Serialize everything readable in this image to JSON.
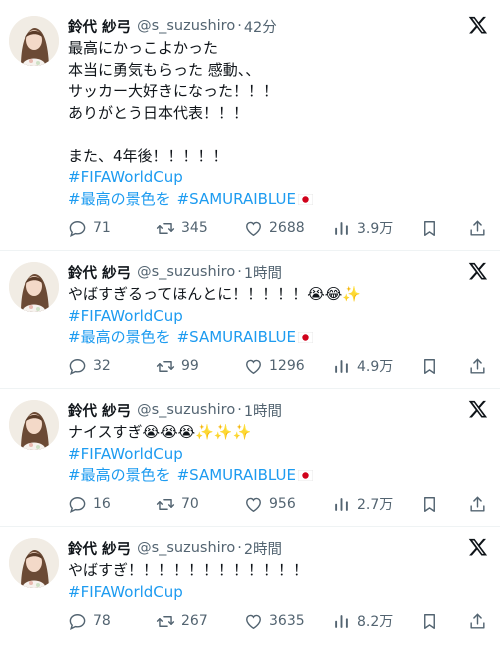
{
  "tweets": [
    {
      "name": "鈴代 紗弓",
      "handle": "@s_suzushiro",
      "dot": "·",
      "time": "42分",
      "lines": [
        "最高にかっこよかった",
        "本当に勇気もらった 感動、、",
        "サッカー大好きになった！！！",
        "ありがとう日本代表！！！",
        "",
        "また、4年後！！！！！"
      ],
      "hashtag1": "#FIFAWorldCup",
      "hashtag2a": "#最高の景色を",
      "hashtag2b": "#SAMURAIBLUE",
      "flag_icon": "japan-flag-icon",
      "replies": "71",
      "retweets": "345",
      "likes": "2688",
      "views": "3.9万"
    },
    {
      "name": "鈴代 紗弓",
      "handle": "@s_suzushiro",
      "dot": "·",
      "time": "1時間",
      "lines": [
        "やばすぎるってほんとに！！！！！😭😂✨"
      ],
      "hashtag1": "#FIFAWorldCup",
      "hashtag2a": "#最高の景色を",
      "hashtag2b": "#SAMURAIBLUE",
      "flag_icon": "japan-flag-icon",
      "replies": "32",
      "retweets": "99",
      "likes": "1296",
      "views": "4.9万"
    },
    {
      "name": "鈴代 紗弓",
      "handle": "@s_suzushiro",
      "dot": "·",
      "time": "1時間",
      "lines": [
        "ナイスすぎ😭😭😭✨✨✨"
      ],
      "hashtag1": "#FIFAWorldCup",
      "hashtag2a": "#最高の景色を",
      "hashtag2b": "#SAMURAIBLUE",
      "flag_icon": "japan-flag-icon",
      "replies": "16",
      "retweets": "70",
      "likes": "956",
      "views": "2.7万"
    },
    {
      "name": "鈴代 紗弓",
      "handle": "@s_suzushiro",
      "dot": "·",
      "time": "2時間",
      "lines": [
        "やばすぎ！！！！！！！！！！！！"
      ],
      "hashtag1": "#FIFAWorldCup",
      "replies": "78",
      "retweets": "267",
      "likes": "3635",
      "views": "8.2万"
    }
  ],
  "icons": {
    "avatar": "avatar",
    "brand": "x-logo-icon",
    "reply": "reply-icon",
    "retweet": "retweet-icon",
    "like": "like-icon",
    "views": "views-icon",
    "bookmark": "bookmark-icon",
    "share": "share-icon"
  },
  "colors": {
    "link": "#1d9bf0",
    "secondary": "#536471",
    "text": "#0f1419",
    "divider": "#eff3f4"
  }
}
